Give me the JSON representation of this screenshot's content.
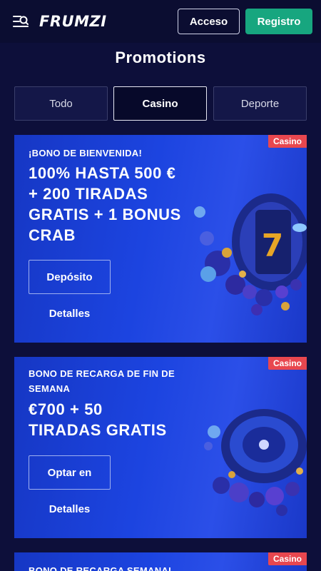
{
  "header": {
    "logo": "FRUMZI",
    "login_label": "Acceso",
    "register_label": "Registro"
  },
  "page": {
    "title": "Promotions"
  },
  "tabs": [
    {
      "label": "Todo",
      "active": false
    },
    {
      "label": "Casino",
      "active": true
    },
    {
      "label": "Deporte",
      "active": false
    }
  ],
  "promos": [
    {
      "badge": "Casino",
      "kicker": "¡BONO DE BIENVENIDA!",
      "headline_lines": [
        "100% HASTA 500 €",
        "+ 200 TIRADAS",
        "GRATIS + 1 BONUS",
        "CRAB"
      ],
      "action": "Depósito",
      "details": "Detalles",
      "art": "slot-reel-art"
    },
    {
      "badge": "Casino",
      "kicker_lines": [
        "BONO DE RECARGA DE FIN DE",
        "SEMANA"
      ],
      "headline_lines": [
        "€700 + 50",
        "TIRADAS GRATIS"
      ],
      "action": "Optar en",
      "details": "Detalles",
      "art": "roulette-art"
    },
    {
      "badge": "Casino",
      "kicker": "BONO DE RECARGA SEMANAL"
    }
  ],
  "colors": {
    "background": "#0d0f3a",
    "register": "#17a67f",
    "badge": "#e8474f",
    "card": "#1c44e0"
  }
}
